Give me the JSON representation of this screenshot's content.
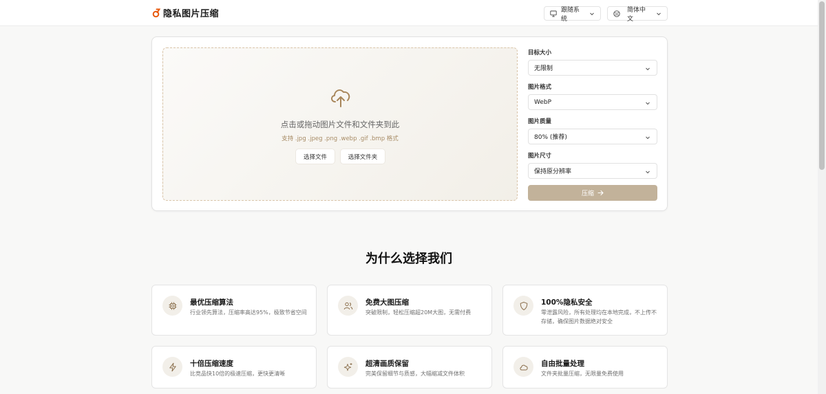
{
  "header": {
    "title": "隐私图片压缩",
    "theme_label": "跟随系统",
    "language_label": "简体中文"
  },
  "upload": {
    "title": "点击或拖动图片文件和文件夹到此",
    "formats": "支持 .jpg .jpeg .png .webp .gif .bmp 格式",
    "select_file": "选择文件",
    "select_folder": "选择文件夹"
  },
  "settings": {
    "target_size_label": "目标大小",
    "target_size_value": "无限制",
    "format_label": "图片格式",
    "format_value": "WebP",
    "quality_label": "图片质量",
    "quality_value": "80% (推荐)",
    "dimension_label": "图片尺寸",
    "dimension_value": "保持原分辨率",
    "compress_label": "压缩"
  },
  "why": {
    "title": "为什么选择我们",
    "features": [
      {
        "icon": "chip-icon",
        "title": "最优压缩算法",
        "desc": "行业领先算法，压缩率高达95%，极致节省空间"
      },
      {
        "icon": "users-icon",
        "title": "免费大图压缩",
        "desc": "突破限制，轻松压缩超20M大图，无需付费"
      },
      {
        "icon": "shield-icon",
        "title": "100%隐私安全",
        "desc": "零泄露风险，所有处理均在本地完成，不上传不存储，确保图片数据绝对安全"
      },
      {
        "icon": "lightning-icon",
        "title": "十倍压缩速度",
        "desc": "比竞品快10倍的极速压缩，更快更清晰"
      },
      {
        "icon": "sparkles-icon",
        "title": "超清画质保留",
        "desc": "完美保留细节与质感，大幅缩减文件体积"
      },
      {
        "icon": "cloud-icon",
        "title": "自由批量处理",
        "desc": "文件夹批量压缩，无限量免费使用"
      }
    ]
  },
  "colors": {
    "accent": "#c2b29a",
    "logo": "#e8590c",
    "icon_stroke": "#8a6e4b"
  }
}
